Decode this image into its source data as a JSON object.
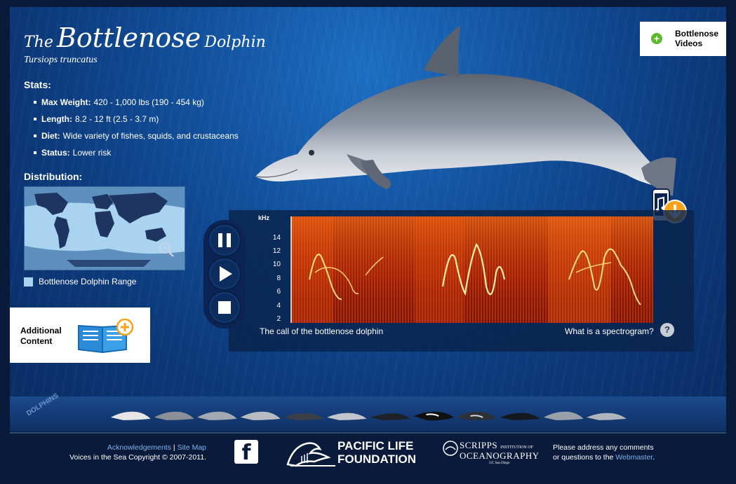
{
  "header": {
    "title_prefix": "The",
    "title_main": "Bottlenose",
    "title_suffix": "Dolphin",
    "scientific_name": "Tursiops truncatus"
  },
  "stats": {
    "heading": "Stats:",
    "items": [
      {
        "label": "Max Weight:",
        "value": "420 - 1,000 lbs (190 - 454 kg)"
      },
      {
        "label": "Length:",
        "value": "8.2 - 12 ft (2.5 - 3.7 m)"
      },
      {
        "label": "Diet:",
        "value": "Wide variety of fishes, squids, and crustaceans"
      },
      {
        "label": "Status:",
        "value": "Lower risk"
      }
    ]
  },
  "distribution": {
    "heading": "Distribution:",
    "legend": "Bottlenose Dolphin Range",
    "zoom_icon": "magnifier-plus-icon"
  },
  "additional": {
    "label_line1": "Additional",
    "label_line2": "Content",
    "icon": "book-plus-icon"
  },
  "videos": {
    "label_line1": "Bottlenose",
    "label_line2": "Videos",
    "icon": "plus-circle-icon"
  },
  "player": {
    "controls": [
      "pause-icon",
      "play-icon",
      "stop-icon"
    ],
    "download_icon": "phone-music-download-icon",
    "spectrogram": {
      "unit": "kHz",
      "y_ticks": [
        "14",
        "12",
        "10",
        "8",
        "6",
        "4",
        "2"
      ],
      "caption": "The call of the bottlenose dolphin",
      "help_text": "What is a spectrogram?",
      "help_icon": "?"
    }
  },
  "shelf": {
    "label": "DOLPHINS",
    "thumbnail_count": 12
  },
  "footer": {
    "link_acknowledgements": "Acknowledgements",
    "separator": "|",
    "link_sitemap": "Site Map",
    "copyright": "Voices in the Sea Copyright © 2007-2011.",
    "facebook_icon": "f",
    "pacific_life_line1": "PACIFIC LIFE",
    "pacific_life_line2": "FOUNDATION",
    "scripps_line1": "SCRIPPS",
    "scripps_line2": "INSTITUTION OF",
    "scripps_line3": "OCEANOGRAPHY",
    "scripps_line4": "UC San Diego",
    "contact_line1": "Please address any comments",
    "contact_line2_prefix": "or questions to the",
    "contact_link": "Webmaster",
    "contact_suffix": "."
  },
  "colors": {
    "ocean": "#12509c",
    "link": "#7fb2ee",
    "accent_orange": "#f7a21b",
    "accent_green": "#5cb82d"
  }
}
